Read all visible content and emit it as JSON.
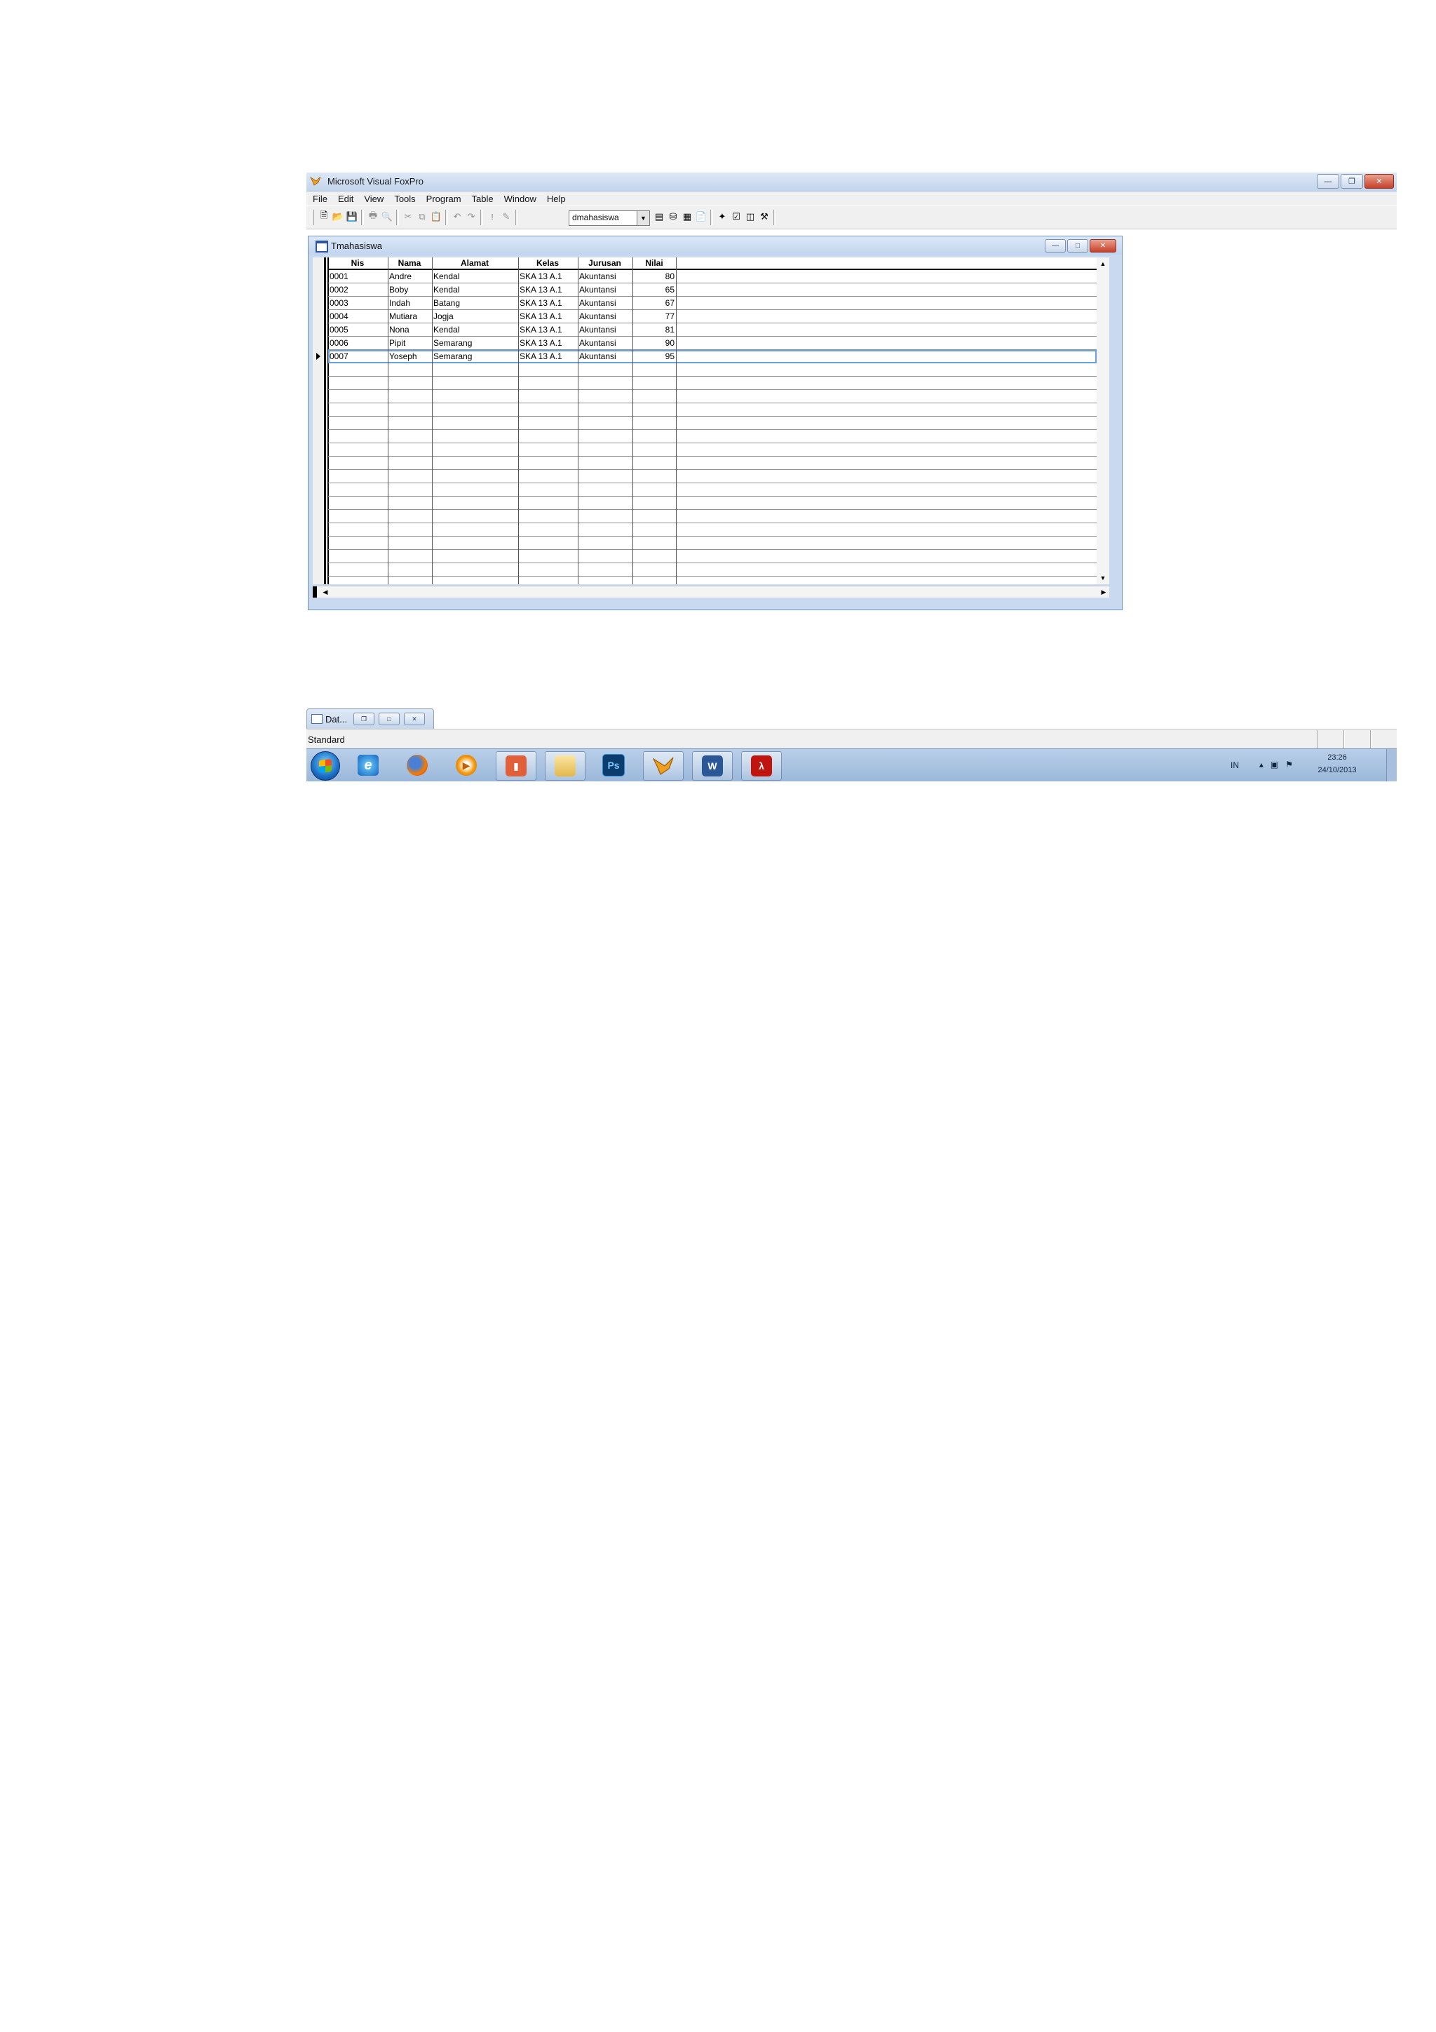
{
  "window": {
    "title": "Microsoft Visual FoxPro"
  },
  "menu": [
    "File",
    "Edit",
    "View",
    "Tools",
    "Program",
    "Table",
    "Window",
    "Help"
  ],
  "toolbar": {
    "database_combo": "dmahasiswa"
  },
  "browse": {
    "title": "Tmahasiswa",
    "columns": [
      "Nis",
      "Nama",
      "Alamat",
      "Kelas",
      "Jurusan",
      "Nilai"
    ],
    "rows": [
      [
        "0001",
        "Andre",
        "Kendal",
        "SKA 13 A.1",
        "Akuntansi",
        "80"
      ],
      [
        "0002",
        "Boby",
        "Kendal",
        "SKA 13 A.1",
        "Akuntansi",
        "65"
      ],
      [
        "0003",
        "Indah",
        "Batang",
        "SKA 13 A.1",
        "Akuntansi",
        "67"
      ],
      [
        "0004",
        "Mutiara",
        "Jogja",
        "SKA 13 A.1",
        "Akuntansi",
        "77"
      ],
      [
        "0005",
        "Nona",
        "Kendal",
        "SKA 13 A.1",
        "Akuntansi",
        "81"
      ],
      [
        "0006",
        "Pipit",
        "Semarang",
        "SKA 13 A.1",
        "Akuntansi",
        "90"
      ],
      [
        "0007",
        "Yoseph",
        "Semarang",
        "SKA 13 A.1",
        "Akuntansi",
        "95"
      ]
    ],
    "active_row": 6
  },
  "minimized": {
    "label": "Dat..."
  },
  "status": {
    "text": "Standard"
  },
  "taskbar": {
    "apps": [
      "internet-explorer",
      "firefox",
      "media-player",
      "powerpoint",
      "explorer",
      "photoshop",
      "visual-foxpro",
      "word",
      "acrobat"
    ],
    "photoshop_label": "Ps",
    "word_label": "W",
    "tray_lang": "IN",
    "time": "23:26",
    "date": "24/10/2013"
  }
}
